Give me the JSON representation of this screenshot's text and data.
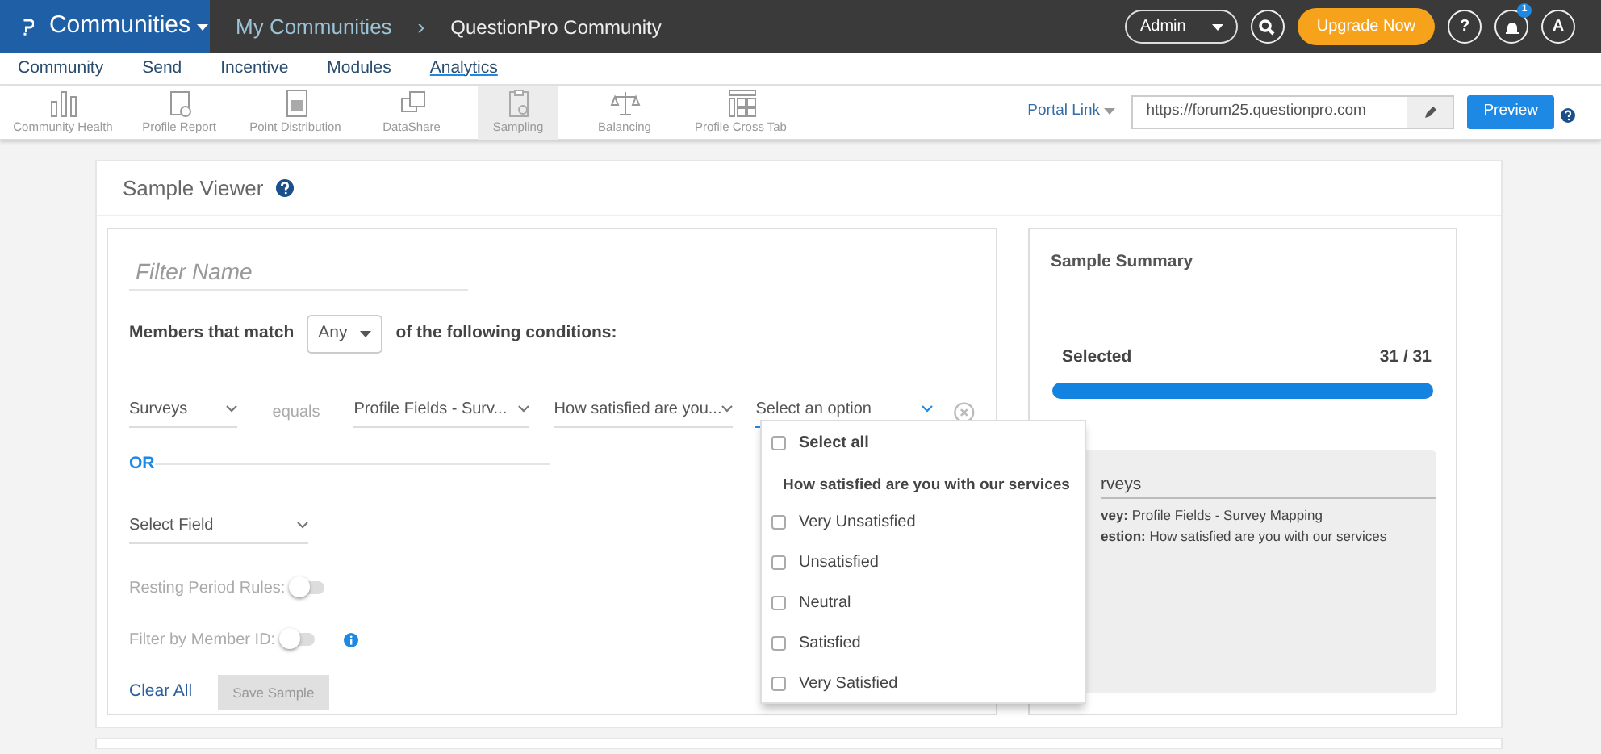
{
  "topbar": {
    "app": "Communities",
    "breadcrumb": [
      "My Communities",
      "QuestionPro Community"
    ],
    "separator": "›",
    "user": "Admin",
    "upgrade": "Upgrade Now",
    "help": "?",
    "notification_count": "1",
    "avatar": "A"
  },
  "nav": [
    {
      "label": "Community",
      "selected": false
    },
    {
      "label": "Send",
      "selected": false
    },
    {
      "label": "Incentive",
      "selected": false
    },
    {
      "label": "Modules",
      "selected": false
    },
    {
      "label": "Analytics",
      "selected": true
    }
  ],
  "toolbar": [
    {
      "label": "Community Health",
      "selected": false
    },
    {
      "label": "Profile Report",
      "selected": false
    },
    {
      "label": "Point Distribution",
      "selected": false
    },
    {
      "label": "DataShare",
      "selected": false
    },
    {
      "label": "Sampling",
      "selected": true
    },
    {
      "label": "Balancing",
      "selected": false
    },
    {
      "label": "Profile Cross Tab",
      "selected": false
    }
  ],
  "portal": {
    "label": "Portal Link",
    "url": "https://forum25.questionpro.com",
    "button": "Preview"
  },
  "page": {
    "title": "Sample Viewer"
  },
  "filter": {
    "placeholder": "Filter Name",
    "match_prefix": "Members that match",
    "match_value": "Any",
    "match_suffix": "of the following conditions:",
    "condition": {
      "field": "Surveys",
      "operator": "equals",
      "source": "Profile Fields - Surv...",
      "question": "How satisfied are you...",
      "option_placeholder": "Select an option"
    },
    "or_label": "OR",
    "select_field": "Select Field",
    "toggles": [
      {
        "label": "Resting Period Rules:",
        "on": false,
        "info": false
      },
      {
        "label": "Filter by Member ID:",
        "on": false,
        "info": true
      }
    ],
    "clear": "Clear All",
    "save": {
      "label": "Save Sample",
      "disabled": true
    }
  },
  "dropdown": {
    "select_all": {
      "label": "Select all",
      "checked": false
    },
    "group": "How satisfied are you with our services",
    "options": [
      {
        "label": "Very Unsatisfied",
        "checked": false
      },
      {
        "label": "Unsatisfied",
        "checked": false
      },
      {
        "label": "Neutral",
        "checked": false
      },
      {
        "label": "Satisfied",
        "checked": false
      },
      {
        "label": "Very Satisfied",
        "checked": false
      }
    ]
  },
  "summary": {
    "title": "Sample Summary",
    "label": "Selected",
    "count": "31 / 31",
    "level": 1.0,
    "group_title": "rveys",
    "lines": [
      {
        "text": "**vey:** Profile Fields - Survey Mapping"
      },
      {
        "text": "**estion:** How satisfied are you with our services"
      }
    ]
  }
}
